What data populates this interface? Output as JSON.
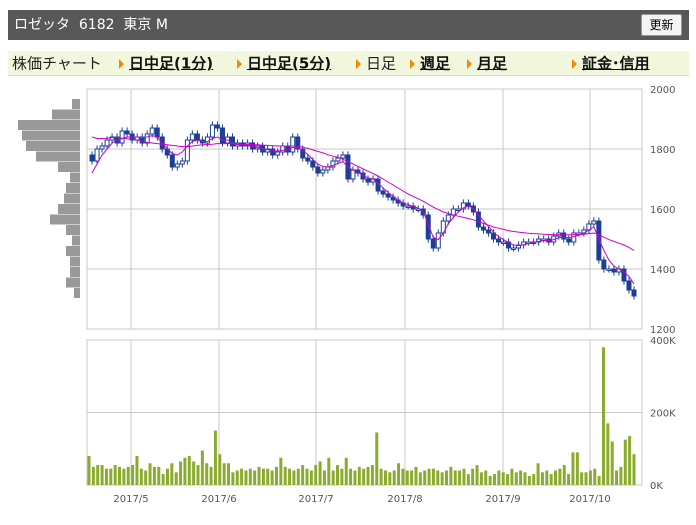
{
  "header": {
    "title": "ロゼッタ  6182  東京 M",
    "refresh_label": "更新"
  },
  "tabs": [
    {
      "label": "株価チャート",
      "active": true,
      "arrow": false
    },
    {
      "label": "日中足(1分)",
      "active": false,
      "arrow": true
    },
    {
      "label": "日中足(5分)",
      "active": false,
      "arrow": true
    },
    {
      "label": "日足",
      "active": true,
      "arrow": true
    },
    {
      "label": "週足",
      "active": false,
      "arrow": true
    },
    {
      "label": "月足",
      "active": false,
      "arrow": true
    },
    {
      "label": "証金･信用",
      "active": false,
      "arrow": true
    }
  ],
  "colors": {
    "up": "#ffffff",
    "down": "#1c3f95",
    "ma": "#cc00cc",
    "volume": "#8bab2e",
    "grid": "#c9c9c9",
    "histogram": "#999999"
  },
  "chart_data": {
    "type": "candlestick",
    "price_axis": {
      "ticks": [
        "2000",
        "1800",
        "1600",
        "1400",
        "1200"
      ],
      "ylim": [
        1200,
        2000
      ]
    },
    "volume_axis": {
      "ticks": [
        "400K",
        "200K",
        "0K"
      ],
      "ylim": [
        0,
        400000
      ]
    },
    "x_labels": [
      "2017/5",
      "2017/6",
      "2017/7",
      "2017/8",
      "2017/9",
      "2017/10"
    ],
    "closes": [
      1760,
      1800,
      1810,
      1830,
      1840,
      1820,
      1860,
      1850,
      1830,
      1840,
      1820,
      1850,
      1870,
      1840,
      1800,
      1780,
      1740,
      1750,
      1760,
      1830,
      1850,
      1830,
      1820,
      1840,
      1880,
      1870,
      1820,
      1840,
      1810,
      1820,
      1810,
      1820,
      1800,
      1810,
      1790,
      1800,
      1780,
      1790,
      1810,
      1790,
      1840,
      1800,
      1770,
      1760,
      1740,
      1720,
      1730,
      1740,
      1760,
      1770,
      1780,
      1700,
      1730,
      1720,
      1700,
      1690,
      1700,
      1660,
      1650,
      1640,
      1630,
      1620,
      1610,
      1610,
      1600,
      1600,
      1580,
      1500,
      1470,
      1520,
      1560,
      1580,
      1600,
      1600,
      1620,
      1610,
      1590,
      1540,
      1530,
      1520,
      1500,
      1490,
      1490,
      1470,
      1470,
      1480,
      1490,
      1490,
      1490,
      1500,
      1500,
      1490,
      1510,
      1520,
      1500,
      1490,
      1520,
      1520,
      1530,
      1550,
      1560,
      1430,
      1400,
      1400,
      1390,
      1400,
      1360,
      1330,
      1310
    ],
    "ma_fast": [
      1720,
      1750,
      1780,
      1800,
      1820,
      1830,
      1835,
      1840,
      1840,
      1840,
      1838,
      1840,
      1845,
      1840,
      1820,
      1800,
      1785,
      1780,
      1790,
      1810,
      1825,
      1830,
      1825,
      1825,
      1835,
      1840,
      1830,
      1830,
      1820,
      1815,
      1815,
      1812,
      1808,
      1805,
      1800,
      1798,
      1795,
      1793,
      1796,
      1797,
      1805,
      1805,
      1795,
      1782,
      1765,
      1750,
      1742,
      1740,
      1745,
      1752,
      1758,
      1740,
      1730,
      1722,
      1712,
      1704,
      1700,
      1685,
      1670,
      1655,
      1642,
      1630,
      1620,
      1615,
      1608,
      1603,
      1592,
      1550,
      1505,
      1498,
      1520,
      1550,
      1572,
      1590,
      1604,
      1610,
      1602,
      1580,
      1560,
      1542,
      1523,
      1508,
      1498,
      1488,
      1480,
      1478,
      1481,
      1485,
      1488,
      1492,
      1495,
      1494,
      1498,
      1504,
      1506,
      1504,
      1508,
      1513,
      1519,
      1530,
      1541,
      1500,
      1462,
      1430,
      1410,
      1400,
      1390,
      1375,
      1350
    ],
    "ma_slow": [
      1840,
      1835,
      1835,
      1836,
      1838,
      1838,
      1836,
      1834,
      1832,
      1830,
      1826,
      1822,
      1820,
      1818,
      1816,
      1814,
      1812,
      1810,
      1808,
      1808,
      1810,
      1812,
      1814,
      1815,
      1816,
      1818,
      1818,
      1818,
      1817,
      1816,
      1815,
      1815,
      1814,
      1814,
      1813,
      1812,
      1811,
      1810,
      1810,
      1810,
      1810,
      1809,
      1806,
      1802,
      1797,
      1792,
      1787,
      1781,
      1776,
      1772,
      1766,
      1758,
      1750,
      1742,
      1734,
      1726,
      1718,
      1710,
      1700,
      1690,
      1680,
      1670,
      1660,
      1650,
      1642,
      1634,
      1626,
      1616,
      1606,
      1598,
      1590,
      1585,
      1580,
      1576,
      1572,
      1568,
      1564,
      1558,
      1552,
      1546,
      1540,
      1536,
      1532,
      1528,
      1525,
      1523,
      1521,
      1519,
      1518,
      1517,
      1516,
      1515,
      1514,
      1514,
      1514,
      1514,
      1514,
      1515,
      1516,
      1518,
      1520,
      1514,
      1506,
      1498,
      1492,
      1486,
      1480,
      1472,
      1462
    ],
    "volumes": [
      80,
      50,
      55,
      55,
      45,
      45,
      55,
      50,
      45,
      50,
      55,
      80,
      45,
      40,
      60,
      50,
      50,
      30,
      45,
      60,
      35,
      65,
      75,
      80,
      65,
      55,
      95,
      60,
      50,
      150,
      85,
      60,
      60,
      35,
      40,
      45,
      40,
      45,
      40,
      50,
      45,
      45,
      40,
      50,
      75,
      50,
      45,
      40,
      45,
      55,
      45,
      40,
      55,
      65,
      40,
      75,
      40,
      55,
      45,
      75,
      45,
      40,
      50,
      45,
      50,
      55,
      145,
      45,
      40,
      35,
      40,
      60,
      45,
      40,
      40,
      50,
      35,
      40,
      45,
      45,
      40,
      35,
      40,
      50,
      40,
      40,
      45,
      30,
      45,
      55,
      35,
      40,
      25,
      30,
      40,
      35,
      30,
      45,
      35,
      40,
      35,
      25,
      30,
      60,
      35,
      40,
      30,
      40,
      45,
      55,
      30,
      90,
      90,
      35,
      35,
      40,
      45,
      25,
      380,
      170,
      120,
      40,
      50,
      125,
      135,
      85
    ],
    "price_histogram": [
      1950,
      1900,
      1850,
      1800,
      1750,
      1700,
      1650,
      1600,
      1550,
      1500,
      1450,
      1400,
      1350,
      1300
    ]
  }
}
